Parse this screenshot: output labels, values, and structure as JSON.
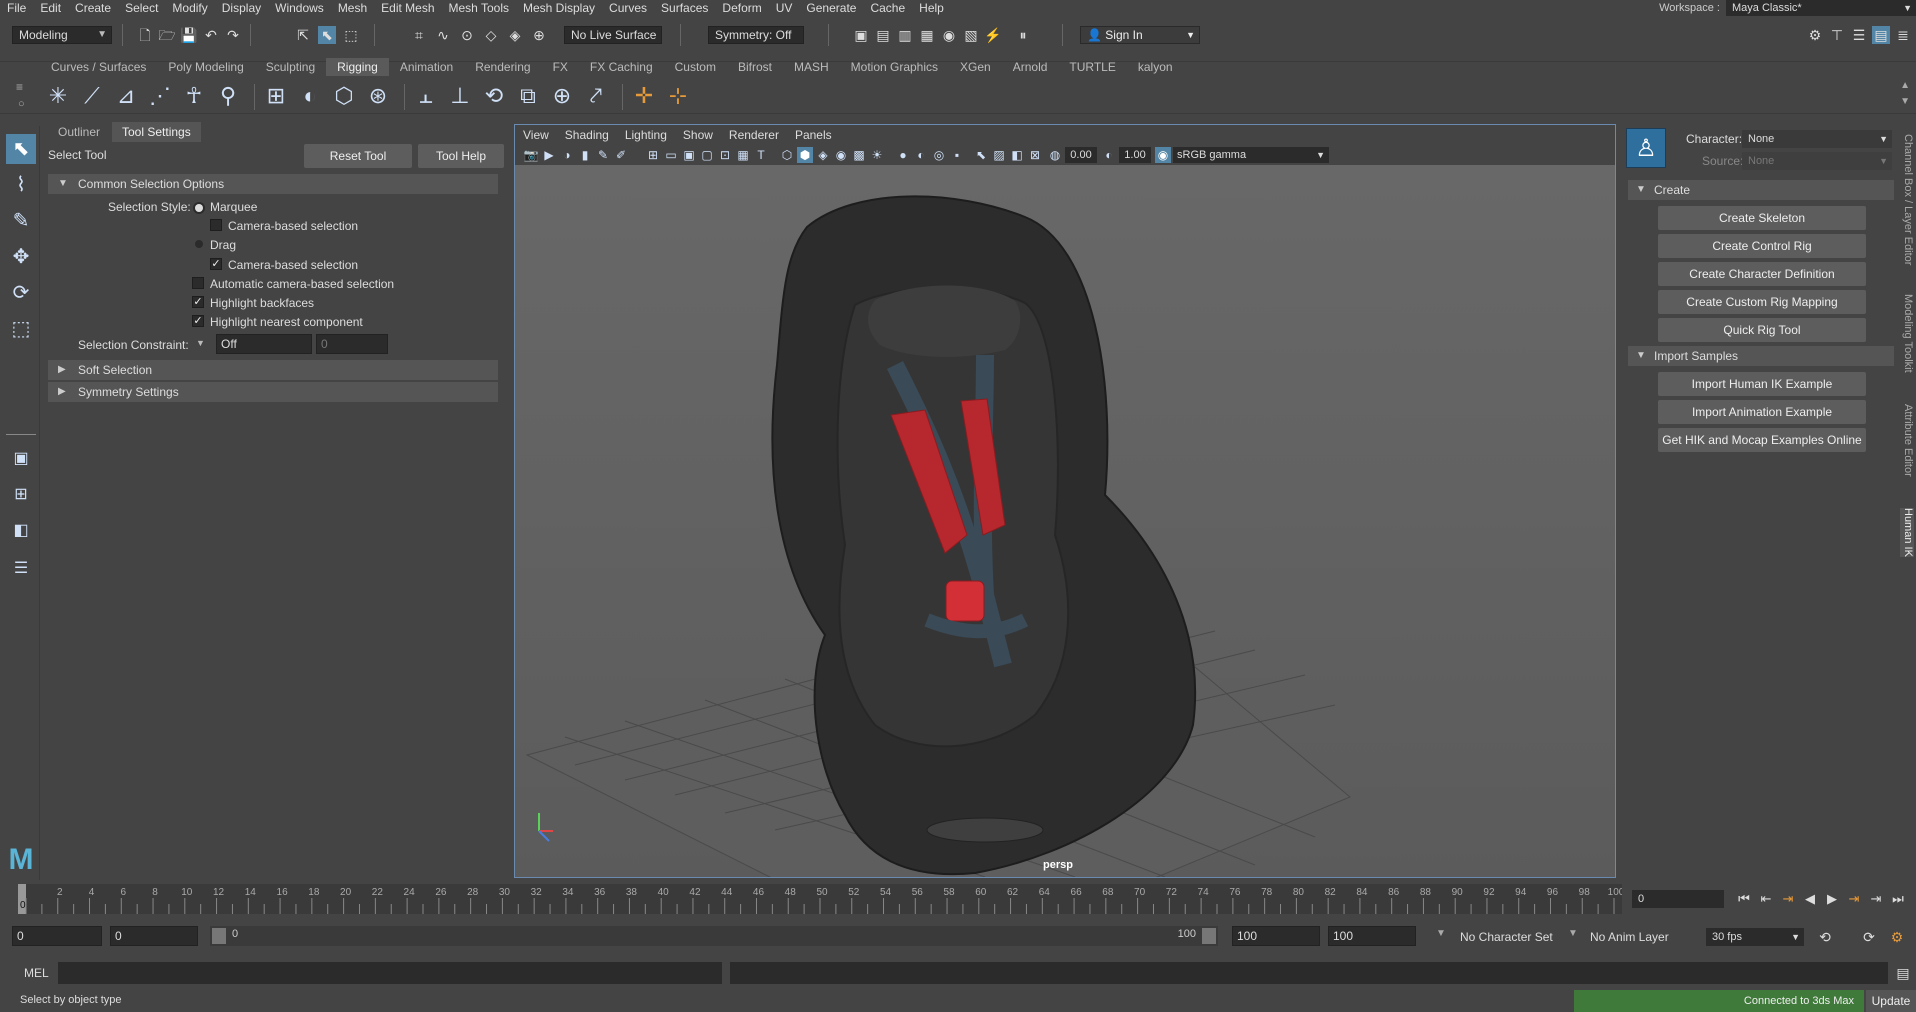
{
  "menubar": {
    "items": [
      "File",
      "Edit",
      "Create",
      "Select",
      "Modify",
      "Display",
      "Windows",
      "Mesh",
      "Edit Mesh",
      "Mesh Tools",
      "Mesh Display",
      "Curves",
      "Surfaces",
      "Deform",
      "UV",
      "Generate",
      "Cache",
      "Help"
    ],
    "workspace_label": "Workspace :",
    "workspace_value": "Maya Classic*"
  },
  "statusline": {
    "mode": "Modeling",
    "live_surface": "No Live Surface",
    "symmetry": "Symmetry: Off",
    "sign_in": "Sign In"
  },
  "shelf": {
    "tabs": [
      "Curves / Surfaces",
      "Poly Modeling",
      "Sculpting",
      "Rigging",
      "Animation",
      "Rendering",
      "FX",
      "FX Caching",
      "Custom",
      "Bifrost",
      "MASH",
      "Motion Graphics",
      "XGen",
      "Arnold",
      "TURTLE",
      "kalyon"
    ],
    "active_tab": "Rigging"
  },
  "tool_settings": {
    "tabs": [
      "Outliner",
      "Tool Settings"
    ],
    "tool_name": "Select Tool",
    "reset_button": "Reset Tool",
    "help_button": "Tool Help",
    "common_section": "Common Selection Options",
    "selection_style_label": "Selection Style:",
    "marquee": "Marquee",
    "camera_based_1": "Camera-based selection",
    "drag": "Drag",
    "camera_based_2": "Camera-based selection",
    "auto_camera": "Automatic camera-based selection",
    "highlight_backfaces": "Highlight backfaces",
    "highlight_nearest": "Highlight nearest component",
    "constraint_label": "Selection Constraint:",
    "constraint_value": "Off",
    "constraint_num": "0",
    "soft_selection": "Soft Selection",
    "symmetry_settings": "Symmetry Settings"
  },
  "viewport": {
    "menus": [
      "View",
      "Shading",
      "Lighting",
      "Show",
      "Renderer",
      "Panels"
    ],
    "exposure": "0.00",
    "gamma": "1.00",
    "color_space": "sRGB gamma",
    "camera_label": "persp"
  },
  "human_ik": {
    "character_label": "Character:",
    "character_value": "None",
    "source_label": "Source:",
    "source_value": "None",
    "create_section": "Create",
    "create_buttons": [
      "Create Skeleton",
      "Create Control Rig",
      "Create Character Definition",
      "Create Custom Rig Mapping",
      "Quick Rig Tool"
    ],
    "import_section": "Import Samples",
    "import_buttons": [
      "Import Human IK Example",
      "Import Animation Example",
      "Get HIK and Mocap Examples Online"
    ]
  },
  "side_tabs": [
    "Channel Box / Layer Editor",
    "Modeling Toolkit",
    "Attribute Editor",
    "Human IK"
  ],
  "timeslider": {
    "ticks": [
      "0",
      "2",
      "4",
      "6",
      "8",
      "10",
      "12",
      "14",
      "16",
      "18",
      "20",
      "22",
      "24",
      "26",
      "28",
      "30",
      "32",
      "34",
      "36",
      "38",
      "40",
      "42",
      "44",
      "46",
      "48",
      "50",
      "52",
      "54",
      "56",
      "58",
      "60",
      "62",
      "64",
      "66",
      "68",
      "70",
      "72",
      "74",
      "76",
      "78",
      "80",
      "82",
      "84",
      "86",
      "88",
      "90",
      "92",
      "94",
      "96",
      "98",
      "100"
    ],
    "current_frame": "0",
    "current_time_field": "0"
  },
  "range": {
    "start": "0",
    "range_start": "0",
    "slider_start": "0",
    "slider_end": "100",
    "range_end": "100",
    "end": "100",
    "character_set": "No Character Set",
    "anim_layer": "No Anim Layer",
    "fps": "30 fps"
  },
  "cmdline": {
    "lang": "MEL"
  },
  "helpline": {
    "text": "Select by object type",
    "connected": "Connected to 3ds Max",
    "update": "Update"
  },
  "colors": {
    "accent": "#5285a6",
    "seat_belt_pad": "#b7272e",
    "connected_bg": "#3f7a3a"
  }
}
